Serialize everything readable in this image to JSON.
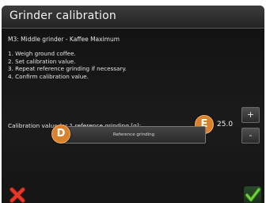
{
  "dialog": {
    "title": "Grinder calibration",
    "subtitle": "M3: Middle grinder  - Kaffee Maximum",
    "steps": [
      "1. Weigh ground coffee.",
      "2. Set calibration value.",
      "3. Repeat reference grinding if necessary.",
      "4. Confirm calibration value."
    ],
    "calibration_label": "Calibration value for 1 reference grinding [g]:",
    "calibration_value": "25.0",
    "plus_label": "+",
    "minus_label": "-",
    "reference_button_label": "Reference grinding"
  },
  "markers": {
    "e": "E",
    "d": "D"
  },
  "icons": {
    "cancel": "close-x-icon",
    "confirm": "checkmark-icon"
  },
  "colors": {
    "background": "#151515",
    "marker": "#d8822e",
    "cancel": "#e53a2a",
    "confirm": "#6fcf3c"
  }
}
